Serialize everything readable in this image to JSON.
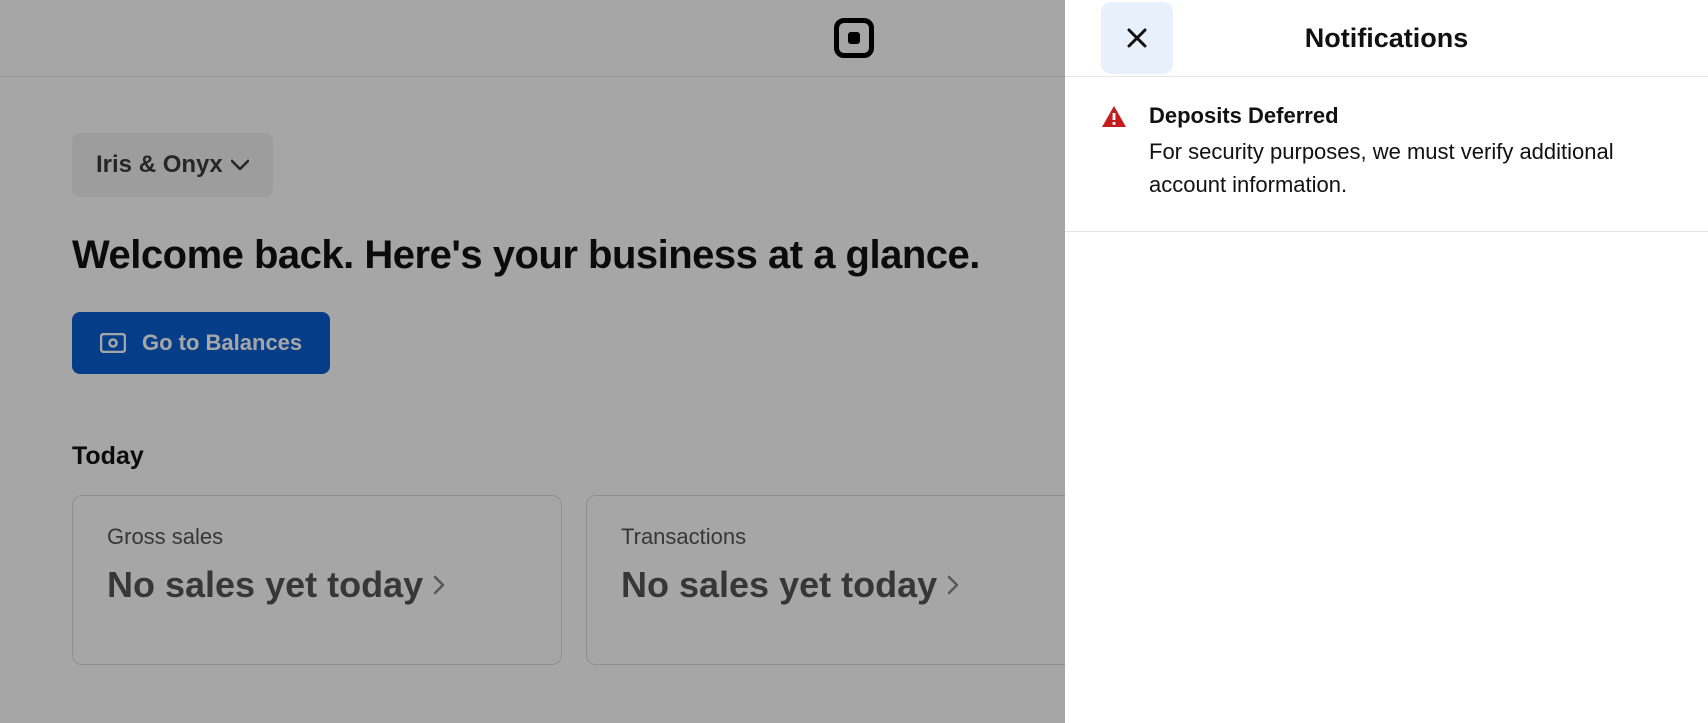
{
  "business": {
    "name": "Iris & Onyx"
  },
  "welcome_text": "Welcome back. Here's your business at a glance.",
  "primary_button": {
    "label": "Go to Balances"
  },
  "section": {
    "title": "Today"
  },
  "cards": [
    {
      "label": "Gross sales",
      "value": "No sales yet today"
    },
    {
      "label": "Transactions",
      "value": "No sales yet today"
    }
  ],
  "panel": {
    "title": "Notifications",
    "notifications": [
      {
        "title": "Deposits Deferred",
        "body": "For security purposes, we must verify additional account information."
      }
    ]
  },
  "colors": {
    "primary_button": "#0a5fd1",
    "close_bg": "#e8f1fb",
    "alert_red": "#c41c1c"
  }
}
